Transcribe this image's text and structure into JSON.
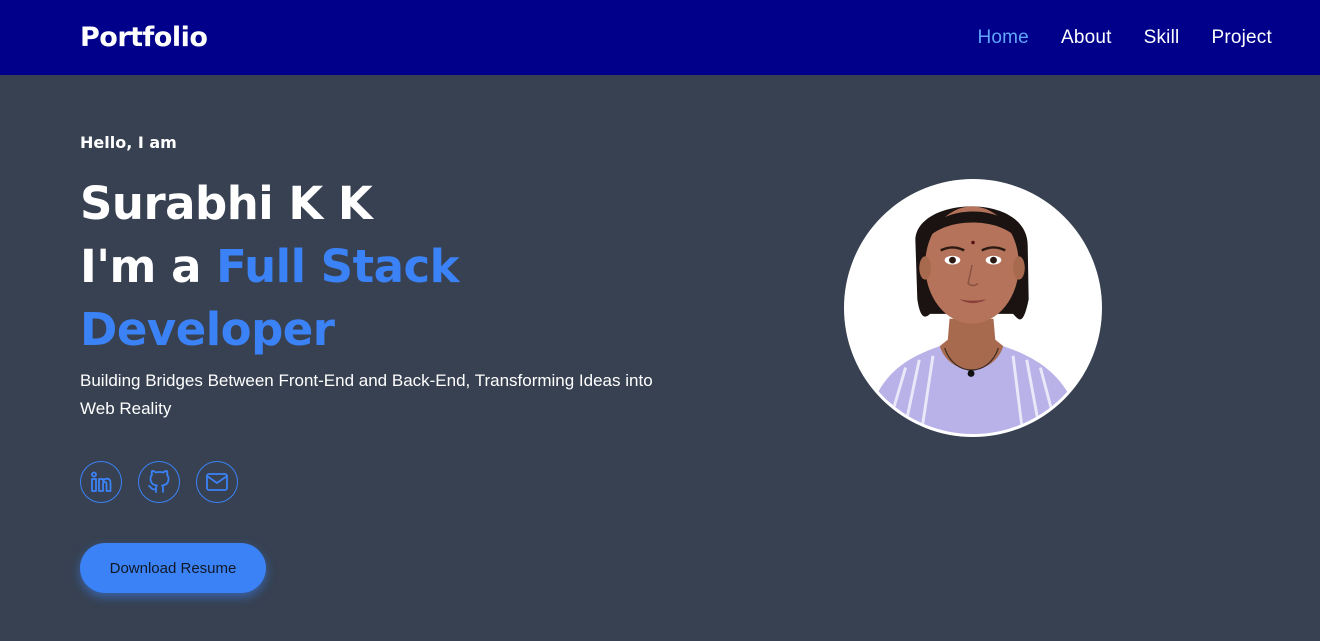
{
  "navbar": {
    "brand": "Portfolio",
    "links": [
      {
        "label": "Home",
        "active": true
      },
      {
        "label": "About",
        "active": false
      },
      {
        "label": "Skill",
        "active": false
      },
      {
        "label": "Project",
        "active": false
      }
    ]
  },
  "hero": {
    "greeting": "Hello, I am",
    "name": "Surabhi K K",
    "role_prefix": "I'm a ",
    "role_accent": "Full Stack Developer",
    "tagline": "Building Bridges Between Front-End and Back-End, Transforming Ideas into Web Reality",
    "socials": [
      {
        "icon": "linkedin-icon"
      },
      {
        "icon": "github-icon"
      },
      {
        "icon": "mail-icon"
      }
    ],
    "resume_button": "Download Resume"
  },
  "colors": {
    "navbar_bg": "#00008b",
    "page_bg": "#374151",
    "accent": "#3b82f6",
    "active_link": "#60a5fa"
  }
}
